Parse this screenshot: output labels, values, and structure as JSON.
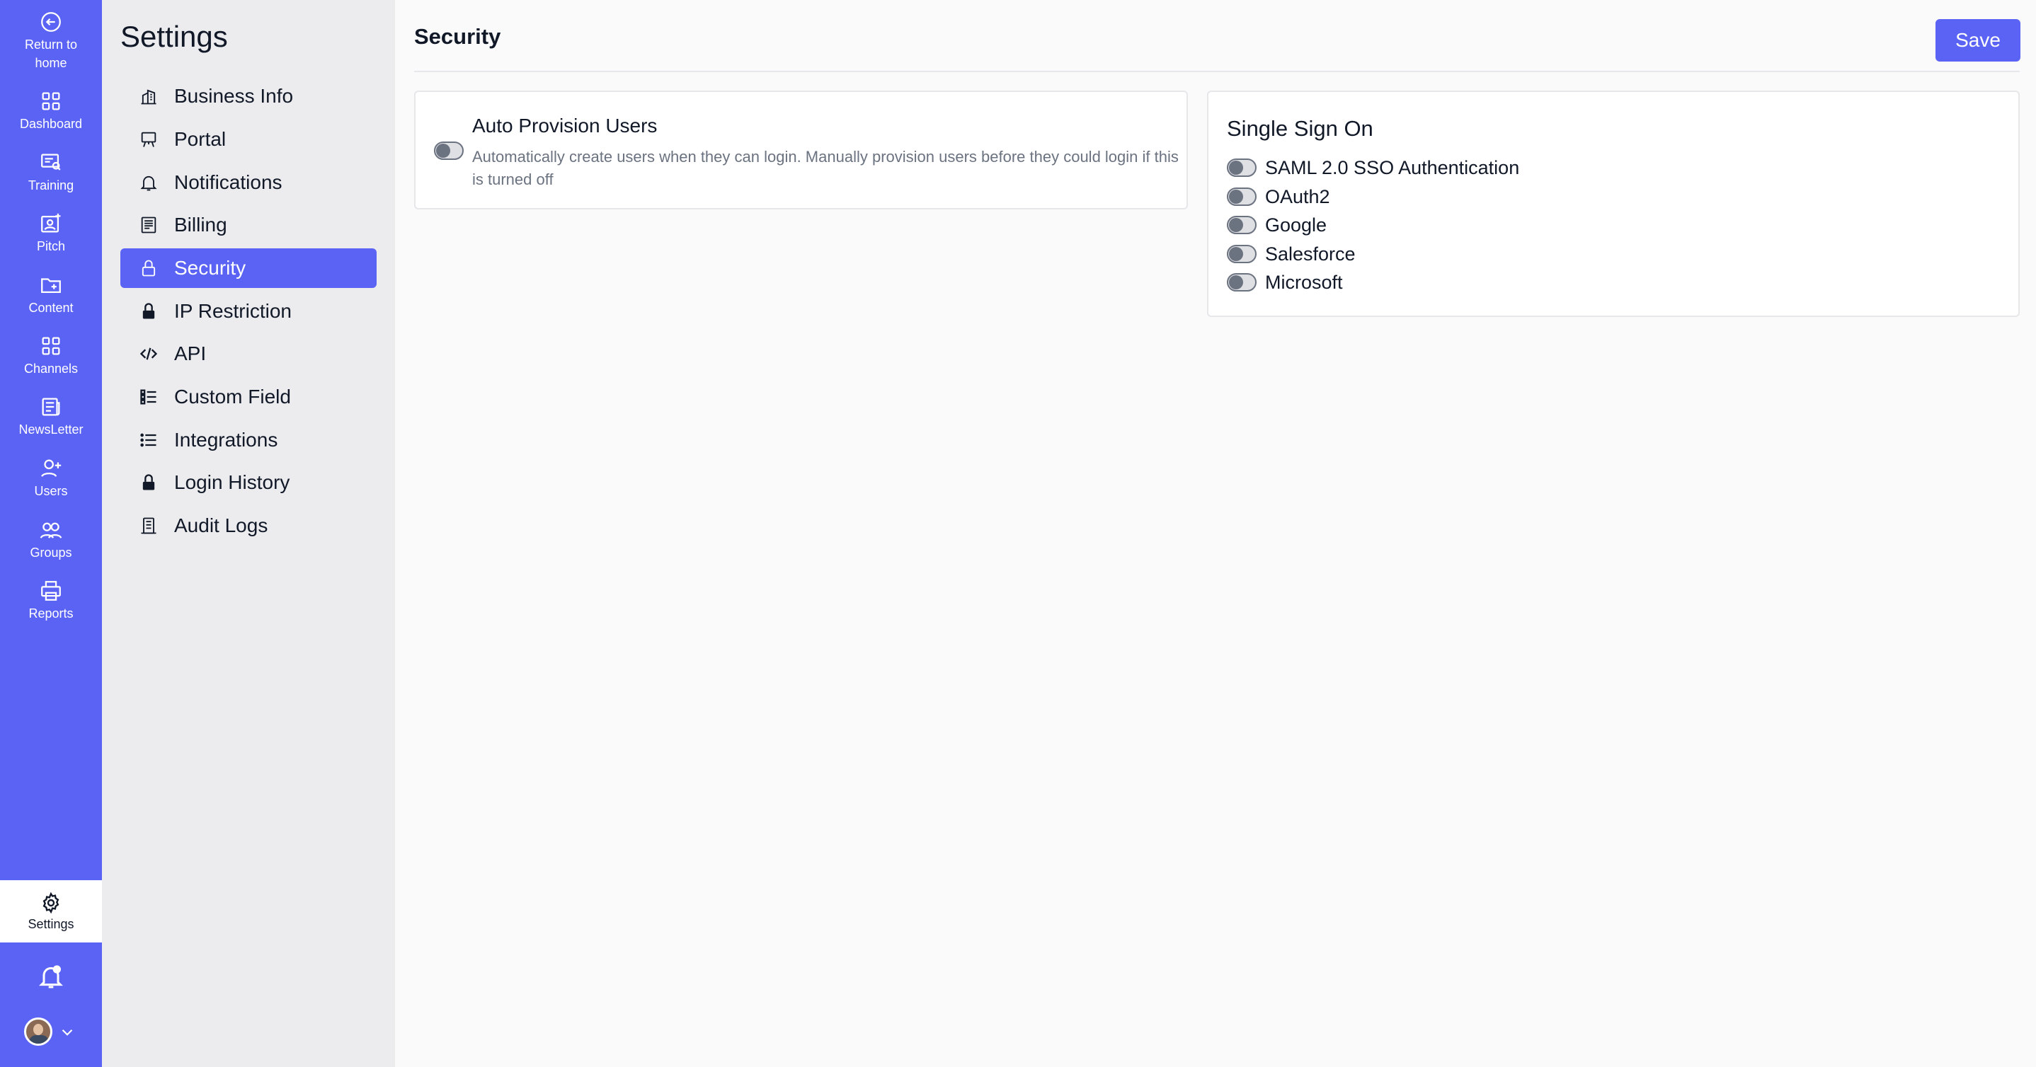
{
  "rail": {
    "items": [
      {
        "label": "Return to\nhome",
        "icon": "return-icon"
      },
      {
        "label": "Dashboard",
        "icon": "dashboard-icon"
      },
      {
        "label": "Training",
        "icon": "training-icon"
      },
      {
        "label": "Pitch",
        "icon": "pitch-icon"
      },
      {
        "label": "Content",
        "icon": "folder-plus-icon"
      },
      {
        "label": "Channels",
        "icon": "channels-icon"
      },
      {
        "label": "NewsLetter",
        "icon": "newsletter-icon"
      },
      {
        "label": "Users",
        "icon": "user-plus-icon"
      },
      {
        "label": "Groups",
        "icon": "groups-icon"
      },
      {
        "label": "Reports",
        "icon": "printer-icon"
      }
    ],
    "settings_label": "Settings"
  },
  "sidebar": {
    "title": "Settings",
    "items": [
      {
        "label": "Business Info",
        "icon": "building-icon"
      },
      {
        "label": "Portal",
        "icon": "easel-icon"
      },
      {
        "label": "Notifications",
        "icon": "bell-icon"
      },
      {
        "label": "Billing",
        "icon": "receipt-icon"
      },
      {
        "label": "Security",
        "icon": "lock-outline-icon",
        "active": true
      },
      {
        "label": "IP Restriction",
        "icon": "lock-icon"
      },
      {
        "label": "API",
        "icon": "code-icon"
      },
      {
        "label": "Custom Field",
        "icon": "fields-icon"
      },
      {
        "label": "Integrations",
        "icon": "list-icon"
      },
      {
        "label": "Login History",
        "icon": "lock-icon"
      },
      {
        "label": "Audit Logs",
        "icon": "audit-icon"
      }
    ]
  },
  "main": {
    "title": "Security",
    "save_label": "Save",
    "auto_provision": {
      "title": "Auto Provision Users",
      "description": "Automatically create users when they can login. Manually provision users before they could login if this is turned off",
      "enabled": false
    },
    "sso": {
      "title": "Single Sign On",
      "options": [
        {
          "label": "SAML 2.0 SSO Authentication",
          "enabled": false
        },
        {
          "label": "OAuth2",
          "enabled": false
        },
        {
          "label": "Google",
          "enabled": false
        },
        {
          "label": "Salesforce",
          "enabled": false
        },
        {
          "label": "Microsoft",
          "enabled": false
        }
      ]
    }
  },
  "colors": {
    "accent": "#5b63f4",
    "sidebar_bg": "#ececee",
    "page_bg": "#fafafa"
  }
}
